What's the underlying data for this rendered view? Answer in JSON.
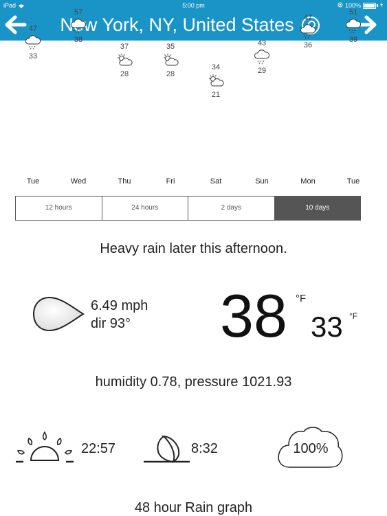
{
  "status": {
    "device": "iPad",
    "time": "5:00 pm",
    "battery": "100%"
  },
  "nav": {
    "title": "New York, NY, United States"
  },
  "forecast": {
    "days": [
      {
        "day": "Tue",
        "high": "47",
        "low": "33",
        "icon": "rain-cloud-icon",
        "level": 0.3
      },
      {
        "day": "Wed",
        "high": "57",
        "low": "38",
        "icon": "rain-cloud-icon",
        "level": 0.0
      },
      {
        "day": "Thu",
        "high": "37",
        "low": "28",
        "icon": "partly-sunny-icon",
        "level": 0.62
      },
      {
        "day": "Fri",
        "high": "35",
        "low": "28",
        "icon": "partly-sunny-icon",
        "level": 0.62
      },
      {
        "day": "Sat",
        "high": "34",
        "low": "21",
        "icon": "partly-sunny-icon",
        "level": 1.0
      },
      {
        "day": "Sun",
        "high": "43",
        "low": "29",
        "icon": "rain-cloud-icon",
        "level": 0.56
      },
      {
        "day": "Mon",
        "high": "47",
        "low": "36",
        "icon": "rain-cloud-icon",
        "level": 0.1
      },
      {
        "day": "Tue",
        "high": "51",
        "low": "39",
        "icon": "rain-cloud-icon",
        "level": 0.0
      }
    ]
  },
  "tabs": {
    "t12": "12 hours",
    "t24": "24 hours",
    "t2d": "2 days",
    "t10d": "10 days"
  },
  "summary": "Heavy rain later this afternoon.",
  "wind": {
    "speed": "6.49 mph",
    "dir": "dir 93°"
  },
  "temp": {
    "current": "38",
    "unit": "°F",
    "low": "33",
    "low_unit": "°F"
  },
  "humidity_line": "humidity 0.78, pressure 1021.93",
  "sun": {
    "rise_time": "22:57",
    "moon_time": "8:32",
    "cloud_cover": "100%"
  },
  "rain_graph_title": "48 hour Rain graph",
  "colors": {
    "accent": "#1a94c6",
    "active_tab": "#555555"
  }
}
